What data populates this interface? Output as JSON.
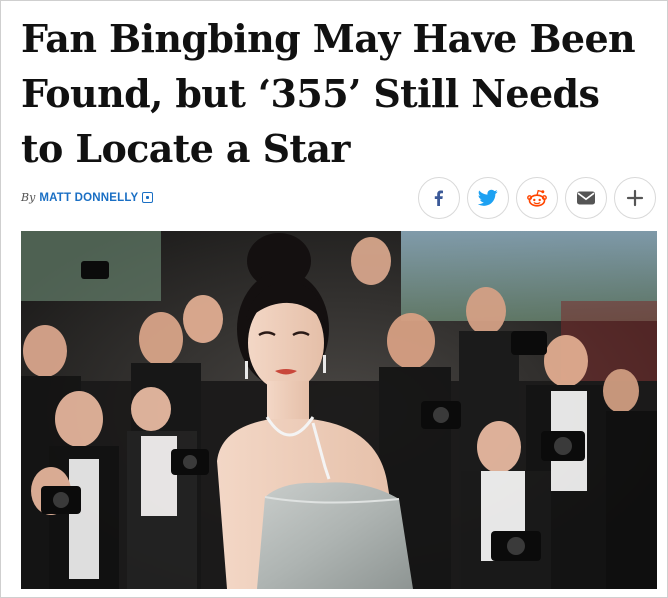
{
  "article": {
    "headline": "Fan Bingbing May Have Been Found, but ‘355’ Still Needs to Locate a Star",
    "byline_prefix": "By",
    "author": "MATT DONNELLY"
  },
  "share": {
    "buttons": [
      {
        "name": "facebook-share-button",
        "icon": "facebook-icon",
        "color": "#3b5998"
      },
      {
        "name": "twitter-share-button",
        "icon": "twitter-icon",
        "color": "#1da1f2"
      },
      {
        "name": "reddit-share-button",
        "icon": "reddit-icon",
        "color": "#ff4500"
      },
      {
        "name": "email-share-button",
        "icon": "envelope-icon",
        "color": "#555555"
      },
      {
        "name": "more-share-button",
        "icon": "plus-icon",
        "color": "#555555"
      }
    ]
  },
  "image": {
    "subject": "photo-fan-bingbing-red-carpet"
  }
}
